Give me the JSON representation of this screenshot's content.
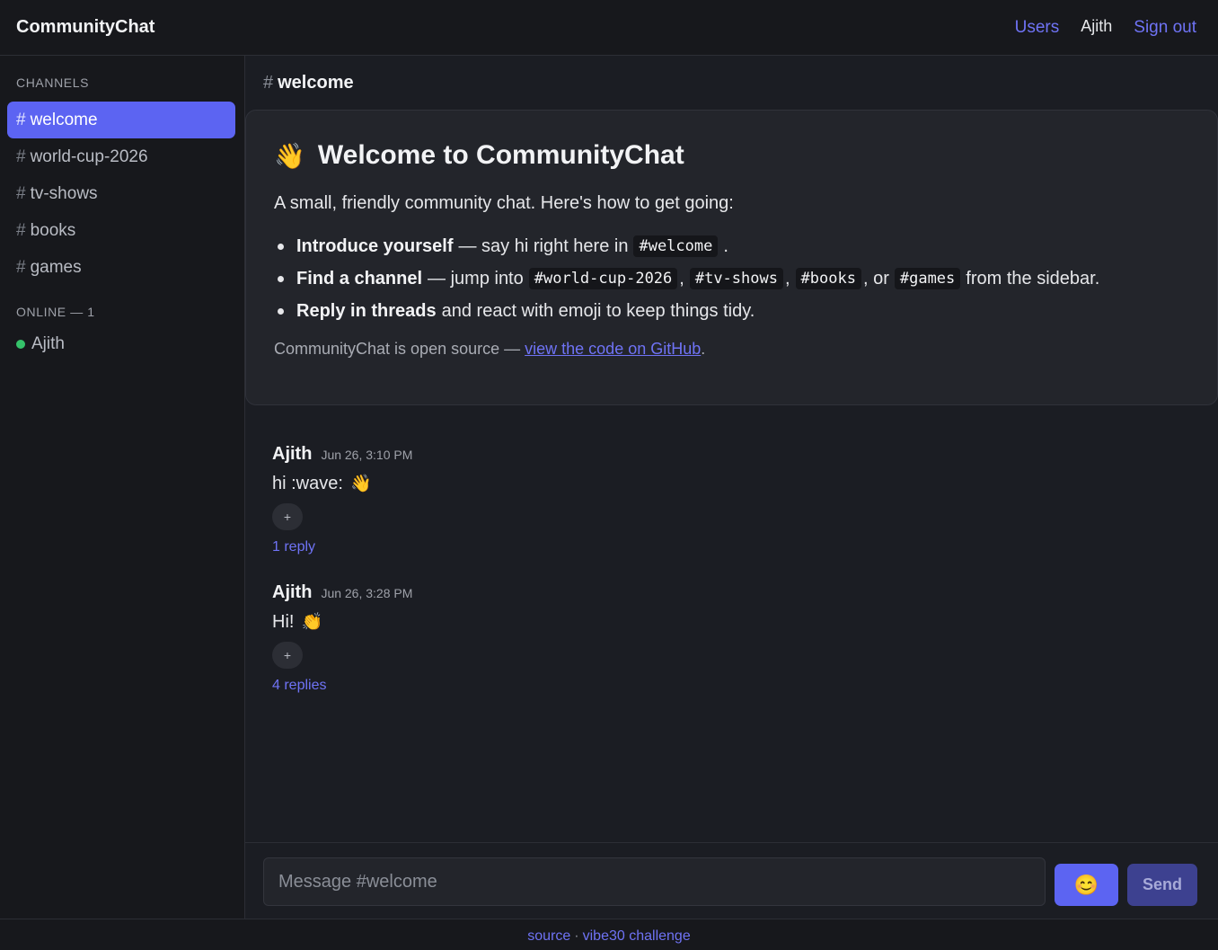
{
  "app": {
    "brand": "CommunityChat",
    "nav": {
      "users": "Users",
      "current_user": "Ajith",
      "sign_out": "Sign out"
    }
  },
  "sidebar": {
    "channels_title": "CHANNELS",
    "channels": [
      {
        "hash": "#",
        "name": "welcome",
        "active": true
      },
      {
        "hash": "#",
        "name": "world-cup-2026"
      },
      {
        "hash": "#",
        "name": "tv-shows"
      },
      {
        "hash": "#",
        "name": "books"
      },
      {
        "hash": "#",
        "name": "games"
      }
    ],
    "online_title": "ONLINE — 1",
    "online_users": [
      {
        "name": "Ajith"
      }
    ]
  },
  "channel_header": {
    "hash": "#",
    "name": "welcome"
  },
  "welcome": {
    "emoji": "👋",
    "title": "Welcome to CommunityChat",
    "intro": "A small, friendly community chat. Here's how to get going:",
    "tips": [
      {
        "bold": "Introduce yourself",
        "text1": "— say hi right here in",
        "code1": "#welcome",
        "text2": "."
      },
      {
        "bold": "Find a channel",
        "text1": "— jump into",
        "code1": "#world-cup-2026",
        "sep1": ",",
        "code2": "#tv-shows",
        "sep2": ",",
        "code3": "#books",
        "sep3": ", or",
        "code4": "#games",
        "text2": "from the sidebar."
      },
      {
        "bold": "Reply in threads",
        "text1": "and react with emoji to keep things tidy."
      }
    ],
    "opensource_text": "CommunityChat is open source —",
    "opensource_link": "view the code on GitHub",
    "opensource_end": "."
  },
  "messages": [
    {
      "author": "Ajith",
      "time": "Jun 26, 3:10 PM",
      "text": "hi :wave:",
      "emoji": "👋",
      "react_label": "+",
      "replies": "1 reply"
    },
    {
      "author": "Ajith",
      "time": "Jun 26, 3:28 PM",
      "text": "Hi!",
      "emoji": "👏",
      "react_label": "+",
      "replies": "4 replies"
    }
  ],
  "composer": {
    "placeholder": "Message #welcome",
    "emoji_button": "😊",
    "send_label": "Send"
  },
  "footer": {
    "source": "source",
    "separator": "·",
    "challenge": "vibe30 challenge"
  }
}
